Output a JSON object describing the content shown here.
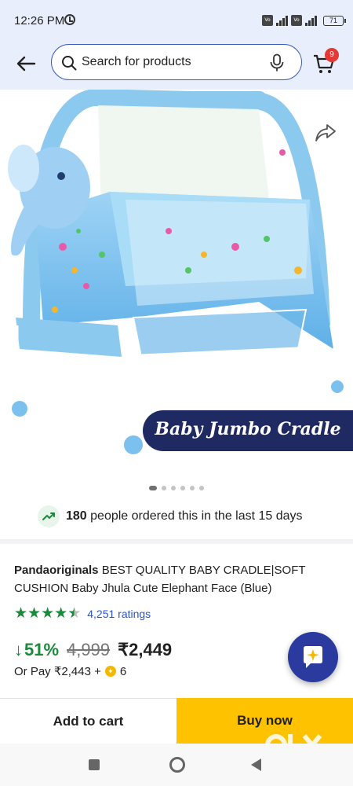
{
  "status_bar": {
    "time": "12:26 PM",
    "battery": "71",
    "icons": [
      "alarm-icon",
      "volte-icon",
      "signal-icon",
      "battery-icon"
    ]
  },
  "header": {
    "search_placeholder": "Search for products",
    "cart_count": "9",
    "icons": [
      "back-arrow-icon",
      "search-icon",
      "mic-icon",
      "cart-icon"
    ]
  },
  "product_image": {
    "banner_text": "Baby Jumbo Cradle",
    "carousel_dot_count": 6,
    "active_dot": 0,
    "icons": [
      "share-icon"
    ]
  },
  "orders": {
    "count": "180",
    "text": "people ordered this in the last 15 days"
  },
  "product": {
    "brand": "Pandaoriginals",
    "title": "BEST QUALITY BABY CRADLE|SOFT CUSHION Baby Jhula Cute Elephant Face (Blue)",
    "rating_stars": 4.5,
    "ratings_count": "4,251 ratings",
    "discount": "51%",
    "mrp": "4,999",
    "price": "₹2,449",
    "or_pay_prefix": "Or Pay ₹2,443 +",
    "coins": "6",
    "colors": {
      "rating_green": "#1b8a3c",
      "link_blue": "#2a55c4",
      "buy_yellow": "#ffc200"
    }
  },
  "actions": {
    "add_to_cart": "Add to cart",
    "buy_now": "Buy now"
  },
  "watermark": "OLX"
}
